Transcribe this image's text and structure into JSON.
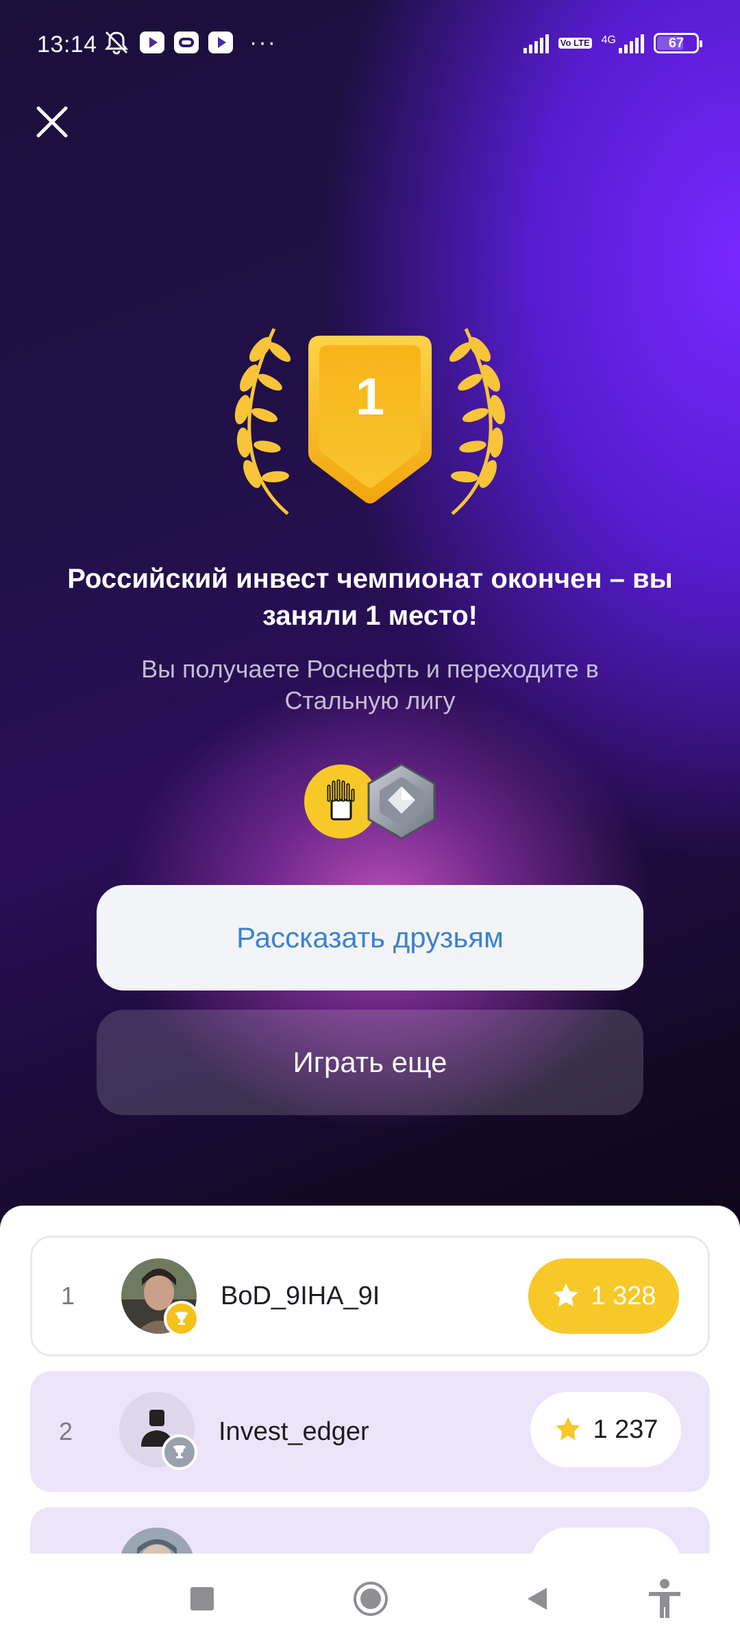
{
  "status_bar": {
    "time": "13:14",
    "battery": "67",
    "battery_level_percent": 67,
    "network": "4G",
    "volte": "Vo LTE",
    "icons": [
      "mute-icon",
      "youtube-icon",
      "ring-app-icon",
      "youtube-icon",
      "more-dots-icon",
      "signal-icon",
      "volte-icon",
      "signal-4g-icon",
      "battery-icon"
    ]
  },
  "header": {
    "close_icon": "close-icon"
  },
  "result": {
    "place_badge": "1",
    "title": "Российский инвест чемпионат окончен – вы заняли 1 место!",
    "subtitle": "Вы получаете Роснефть и переходите в Стальную лигу",
    "reward_icons": [
      "rosneft-coin-icon",
      "steel-league-badge-icon"
    ]
  },
  "actions": {
    "share_label": "Рассказать друзьям",
    "play_again_label": "Играть еще"
  },
  "leaderboard": {
    "rows": [
      {
        "rank": "1",
        "name": "BoD_9IHA_9I",
        "score": "1 328",
        "medal": "gold"
      },
      {
        "rank": "2",
        "name": "Invest_edger",
        "score": "1 237",
        "medal": "silver"
      },
      {
        "rank": "3",
        "name": "",
        "score": "",
        "medal": ""
      }
    ]
  },
  "colors": {
    "gold": "#f7c928",
    "purple_highlight": "#ece5fa",
    "share_text": "#3b82d0"
  },
  "nav_bar": {
    "icons": [
      "recents-square-icon",
      "home-circle-icon",
      "back-triangle-icon",
      "accessibility-icon"
    ]
  }
}
